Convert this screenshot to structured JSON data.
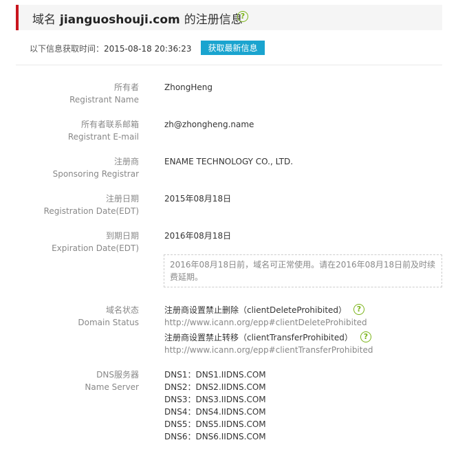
{
  "header": {
    "prefix": "域名",
    "domain": "jianguoshouji.com",
    "suffix": "的注册信息",
    "help_icon": "?"
  },
  "fetch": {
    "label": "以下信息获取时间：",
    "time": "2015-08-18 20:36:23",
    "button_label": "获取最新信息"
  },
  "fields": {
    "registrant_name": {
      "label_cn": "所有者",
      "label_en": "Registrant Name",
      "value": "ZhongHeng"
    },
    "registrant_email": {
      "label_cn": "所有者联系邮箱",
      "label_en": "Registrant E-mail",
      "value": "zh@zhongheng.name"
    },
    "registrar": {
      "label_cn": "注册商",
      "label_en": "Sponsoring Registrar",
      "value": "ENAME TECHNOLOGY CO., LTD."
    },
    "registration_date": {
      "label_cn": "注册日期",
      "label_en": "Registration Date(EDT)",
      "value": "2015年08月18日"
    },
    "expiration_date": {
      "label_cn": "到期日期",
      "label_en": "Expiration Date(EDT)",
      "value": "2016年08月18日"
    }
  },
  "notice": "2016年08月18日前，域名可正常使用。请在2016年08月18日前及时续费延期。",
  "domain_status": {
    "label_cn": "域名状态",
    "label_en": "Domain Status",
    "items": [
      {
        "text": "注册商设置禁止删除（clientDeleteProhibited）",
        "url": "http://www.icann.org/epp#clientDeleteProhibited"
      },
      {
        "text": "注册商设置禁止转移（clientTransferProhibited）",
        "url": "http://www.icann.org/epp#clientTransferProhibited"
      }
    ]
  },
  "dns": {
    "label_cn": "DNS服务器",
    "label_en": "Name Server",
    "servers": [
      "DNS1：DNS1.IIDNS.COM",
      "DNS2：DNS2.IIDNS.COM",
      "DNS3：DNS3.IIDNS.COM",
      "DNS4：DNS4.IIDNS.COM",
      "DNS5：DNS5.IIDNS.COM",
      "DNS6：DNS6.IIDNS.COM"
    ]
  },
  "colors": {
    "accent": "#c9151e",
    "button": "#1aa4cf",
    "help": "#7ab317"
  }
}
